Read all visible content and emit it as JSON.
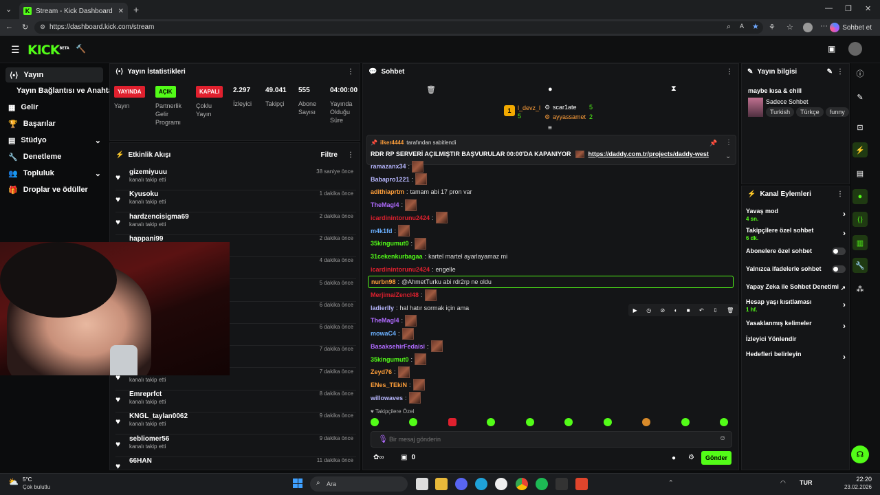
{
  "browser": {
    "tab_title": "Stream - Kick Dashboard",
    "url": "https://dashboard.kick.com/stream",
    "sohbet_label": "Sohbet et"
  },
  "brand": {
    "logo": "KICK",
    "beta": "BETA",
    "accent": "#53fc18"
  },
  "leftnav": {
    "items": [
      {
        "label": "Yayın",
        "icon": "broadcast-icon"
      },
      {
        "label": "Yayın Bağlantısı ve Anahtarı"
      },
      {
        "label": "Gelir",
        "icon": "money-icon"
      },
      {
        "label": "Başarılar",
        "icon": "trophy-icon"
      },
      {
        "label": "Stüdyo",
        "icon": "studio-icon"
      },
      {
        "label": "Denetleme",
        "icon": "wrench-icon"
      },
      {
        "label": "Topluluk",
        "icon": "community-icon"
      },
      {
        "label": "Droplar ve ödüller",
        "icon": "gift-icon"
      }
    ]
  },
  "stats": {
    "title": "Yayın İstatistikleri",
    "badges": [
      {
        "text": "YAYINDA",
        "label": "Yayın",
        "color": "#e0202e"
      },
      {
        "text": "AÇIK",
        "label": "Partnerlik Gelir Programı",
        "color": "#53fc18"
      },
      {
        "text": "KAPALI",
        "label": "Çoklu Yayın",
        "color": "#e0202e"
      }
    ],
    "numbers": [
      {
        "value": "2.297",
        "label": "İzleyici"
      },
      {
        "value": "49.041",
        "label": "Takipçi"
      },
      {
        "value": "555",
        "label": "Abone Sayısı"
      },
      {
        "value": "04:00:00",
        "label": "Yayında Olduğu Süre"
      }
    ]
  },
  "activity": {
    "title": "Etkinlik Akışı",
    "filter": "Filtre",
    "items": [
      {
        "name": "gizemiyuuu",
        "sub": "kanalı takip etti",
        "time": "38 saniye önce"
      },
      {
        "name": "Kyusoku",
        "sub": "kanalı takip etti",
        "time": "1 dakika önce"
      },
      {
        "name": "hardzencisigma69",
        "sub": "kanalı takip etti",
        "time": "2 dakika önce"
      },
      {
        "name": "happani99",
        "sub": "kanalı takip etti",
        "time": "2 dakika önce"
      },
      {
        "name": "",
        "sub": "",
        "time": "4 dakika önce"
      },
      {
        "name": "",
        "sub": "",
        "time": "5 dakika önce"
      },
      {
        "name": "",
        "sub": "",
        "time": "6 dakika önce"
      },
      {
        "name": "",
        "sub": "",
        "time": "6 dakika önce"
      },
      {
        "name": "",
        "sub": "",
        "time": "7 dakika önce"
      },
      {
        "name": "",
        "sub": "kanalı takip etti",
        "time": "7 dakika önce"
      },
      {
        "name": "Emreprfct",
        "sub": "kanalı takip etti",
        "time": "8 dakika önce"
      },
      {
        "name": "KNGL_taylan0062",
        "sub": "kanalı takip etti",
        "time": "9 dakika önce"
      },
      {
        "name": "sebliomer56",
        "sub": "kanalı takip etti",
        "time": "9 dakika önce"
      },
      {
        "name": "66HAN",
        "sub": "",
        "time": "11 dakika önce"
      }
    ]
  },
  "chat": {
    "title": "Sohbet",
    "leaderboard": [
      {
        "rank": "1",
        "name": "l_devz_l",
        "count": "5"
      },
      {
        "name": "scar1ate",
        "count": "5"
      },
      {
        "name": "ayyassamet",
        "count": "2"
      }
    ],
    "pinned": {
      "by_user": "ilker4444",
      "by_text": "tarafından sabitlendi",
      "text": "RDR RP SERVERİ AÇILMIŞTIR BAŞVURULAR 00:00'DA KAPANIYOR",
      "link": "https://daddy.com.tr/projects/daddy-west"
    },
    "messages": [
      {
        "user": "ramazanx34",
        "color": "#b8b8ff",
        "text": "",
        "emote": true
      },
      {
        "user": "Babapro1221",
        "color": "#b8b8ff",
        "text": "",
        "emote": true
      },
      {
        "user": "adithiaprtm",
        "color": "#ff9f3a",
        "text": "tamam abi 17 pron var",
        "emote": false
      },
      {
        "user": "TheMagl4",
        "color": "#b06bff",
        "text": "",
        "emote": true
      },
      {
        "user": "icardinintorunu2424",
        "color": "#e0202e",
        "text": "",
        "emote": true
      },
      {
        "user": "m4k1fd",
        "color": "#6bb0ff",
        "text": "",
        "emote": true
      },
      {
        "user": "35kingumut0",
        "color": "#53fc18",
        "text": "",
        "emote": true
      },
      {
        "user": "31cekenkurbagaa",
        "color": "#53fc18",
        "text": "kartel martel ayarlayamaz mi",
        "emote": false
      },
      {
        "user": "icardinintorunu2424",
        "color": "#e0202e",
        "text": "engelle",
        "emote": false
      },
      {
        "user": "nurbn98",
        "color": "#ff9f3a",
        "text": "@AhmetTurku abi rdr2rp ne oldu",
        "emote": false,
        "mention": true
      },
      {
        "user": "MerjimaiZencl48",
        "color": "#e0202e",
        "text": "",
        "emote": true
      },
      {
        "user": "ladierlly",
        "color": "#b8b8ff",
        "text": "hal hatır sormak için ama",
        "emote": false
      },
      {
        "user": "TheMagl4",
        "color": "#b06bff",
        "text": "",
        "emote": true
      },
      {
        "user": "mowaC4",
        "color": "#6bb0ff",
        "text": "",
        "emote": true
      },
      {
        "user": "BasaksehirFedaisi",
        "color": "#b06bff",
        "text": "",
        "emote": true
      },
      {
        "user": "35kingumut0",
        "color": "#53fc18",
        "text": "",
        "emote": true
      },
      {
        "user": "Zeyd76",
        "color": "#ff9f3a",
        "text": "",
        "emote": true
      },
      {
        "user": "ENes_TEkiN",
        "color": "#ff9f3a",
        "text": "",
        "emote": true
      },
      {
        "user": "willowaves",
        "color": "#b8b8ff",
        "text": "",
        "emote": true
      }
    ],
    "mode_label": "Takipçilere Özel",
    "input_placeholder": "Bir mesaj gönderin",
    "count_label": "0",
    "send": "Gönder"
  },
  "streaminfo": {
    "title": "Yayın bilgisi",
    "stream_title": "maybe kısa & chill",
    "category": "Sadece Sohbet",
    "tags": [
      "Turkish",
      "Türkçe",
      "funny"
    ]
  },
  "channel": {
    "title": "Kanal Eylemleri",
    "items": [
      {
        "label": "Yavaş mod",
        "value": "4 sn.",
        "type": "chev"
      },
      {
        "label": "Takipçilere özel sohbet",
        "value": "6 dk.",
        "type": "chev"
      },
      {
        "label": "Abonelere özel sohbet",
        "value": "",
        "type": "toggle"
      },
      {
        "label": "Yalnızca ifadelerle sohbet",
        "value": "",
        "type": "toggle"
      },
      {
        "label": "Yapay Zeka ile Sohbet Denetimi",
        "value": "",
        "type": "ext"
      },
      {
        "label": "Hesap yaşı kısıtlaması",
        "value": "1 hf.",
        "type": "chev"
      },
      {
        "label": "Yasaklanmış kelimeler",
        "value": "",
        "type": "chev"
      },
      {
        "label": "İzleyici Yönlendir",
        "value": "",
        "type": "none"
      },
      {
        "label": "Hedefleri belirleyin",
        "value": "",
        "type": "chev"
      }
    ]
  },
  "taskbar": {
    "weather_temp": "5°C",
    "weather_desc": "Çok bulutlu",
    "search": "Ara",
    "lang": "TUR",
    "time": "22:20",
    "date": "23.02.2026"
  }
}
